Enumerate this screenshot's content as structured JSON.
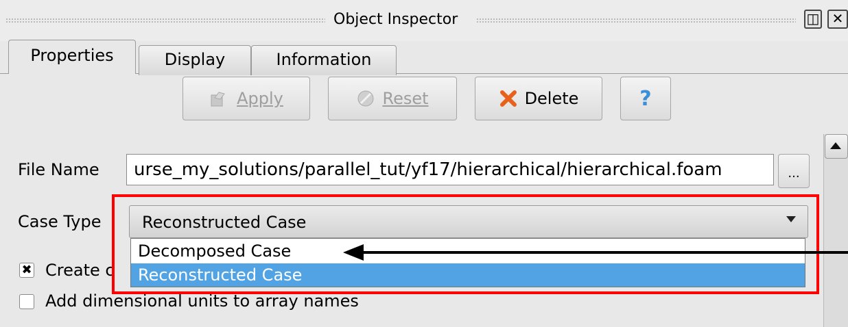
{
  "window": {
    "title": "Object Inspector"
  },
  "tabs": [
    {
      "label": "Properties",
      "active": true
    },
    {
      "label": "Display",
      "active": false
    },
    {
      "label": "Information",
      "active": false
    }
  ],
  "toolbar": {
    "apply_label": "Apply",
    "reset_label": "Reset",
    "delete_label": "Delete",
    "help_label": "?"
  },
  "properties": {
    "file_name_label": "File Name",
    "file_name_value": "urse_my_solutions/parallel_tut/yf17/hierarchical/hierarchical.foam",
    "browse_label": "...",
    "case_type_label": "Case Type",
    "case_type_value": "Reconstructed Case",
    "case_type_options": [
      "Decomposed Case",
      "Reconstructed Case"
    ],
    "create_label_partial": "Create c",
    "add_units_label": "Add dimensional units to array names"
  },
  "colors": {
    "selection": "#51a3e3",
    "annotation": "#ff0000",
    "delete_icon": "#e8611c",
    "help_icon": "#3a8fd6"
  },
  "icons": [
    "apply-icon",
    "reset-icon",
    "delete-icon",
    "help-icon",
    "float-icon",
    "close-icon",
    "chevron-down-icon",
    "scroll-up-icon"
  ]
}
